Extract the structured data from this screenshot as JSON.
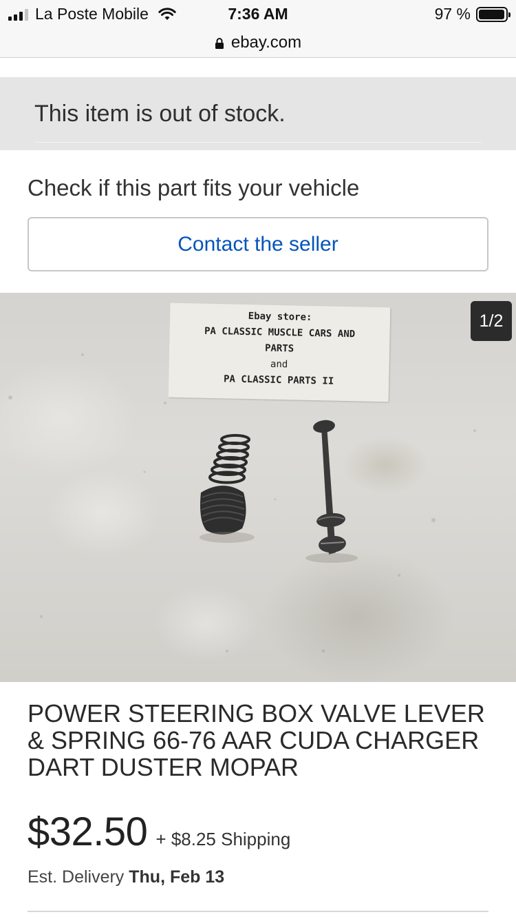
{
  "status_bar": {
    "carrier": "La Poste Mobile",
    "time": "7:36 AM",
    "battery": "97 %",
    "battery_level": 0.97
  },
  "browser": {
    "url": "ebay.com"
  },
  "stock_notice": "This item is out of stock.",
  "fitment": {
    "title": "Check if this part fits your vehicle",
    "contact_label": "Contact the seller"
  },
  "gallery": {
    "counter": "1/2",
    "note_lines": [
      "Ebay store:",
      "PA CLASSIC MUSCLE CARS AND",
      "PARTS",
      "and",
      "PA CLASSIC PARTS II"
    ]
  },
  "listing": {
    "title": "POWER STEERING BOX VALVE LEVER & SPRING 66-76 AAR CUDA CHARGER DART DUSTER MOPAR",
    "price": "$32.50",
    "shipping": "+ $8.25 Shipping",
    "delivery_label": "Est. Delivery",
    "delivery_date": "Thu, Feb 13"
  }
}
